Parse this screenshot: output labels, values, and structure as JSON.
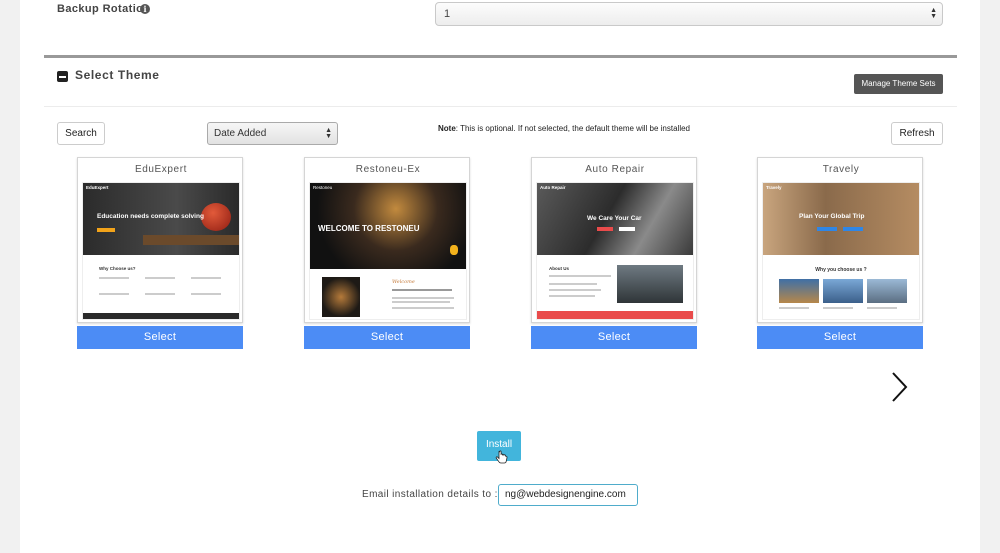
{
  "backup": {
    "label": "Backup Rotation",
    "info_icon": "info-icon",
    "value": "1"
  },
  "theme_section": {
    "title": "Select Theme",
    "collapse_icon": "minus-square-icon",
    "manage_button": "Manage Theme Sets"
  },
  "toolbar": {
    "search_button": "Search",
    "sort_value": "Date Added",
    "note_bold": "Note",
    "note_text": ": This is optional. If not selected, the default theme will be installed",
    "refresh_button": "Refresh"
  },
  "themes": [
    {
      "name": "EduExpert",
      "thumb_brand": "EduExpert",
      "thumb_headline": "Education needs complete solving",
      "thumb_section": "Why Choose us?",
      "select_label": "Select"
    },
    {
      "name": "Restoneu-Ex",
      "thumb_brand": "Restoneu",
      "thumb_headline": "WELCOME TO RESTONEU",
      "thumb_section": "Welcome",
      "select_label": "Select"
    },
    {
      "name": "Auto Repair",
      "thumb_brand": "Auto Repair",
      "thumb_headline": "We Care Your Car",
      "thumb_section": "About Us",
      "select_label": "Select"
    },
    {
      "name": "Travely",
      "thumb_brand": "Travely",
      "thumb_headline": "Plan Your Global Trip",
      "thumb_section": "Why you choose us ?",
      "select_label": "Select"
    }
  ],
  "carousel": {
    "next_icon": "chevron-right-icon"
  },
  "install": {
    "button": "Install",
    "cursor_icon": "hand-pointer-icon"
  },
  "email": {
    "label": "Email installation details to :",
    "value": "ng@webdesignengine.com"
  },
  "colors": {
    "select_blue": "#4c8cf5",
    "install_blue": "#42b5dc",
    "manage_gray": "#555555"
  }
}
